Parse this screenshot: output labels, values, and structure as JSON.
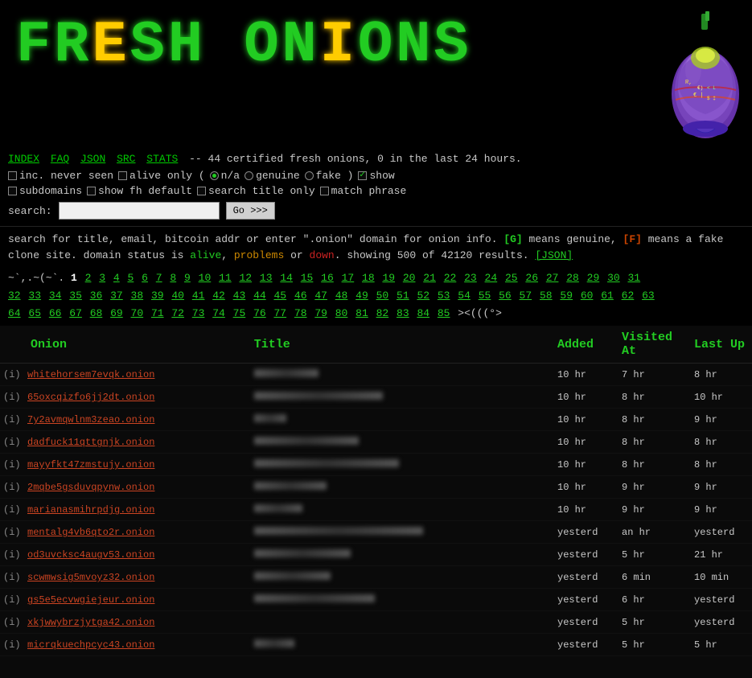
{
  "header": {
    "logo": "FRESH ONIONS",
    "tagline": "-- 44 certified fresh onions, 0 in the last 24 hours."
  },
  "nav": {
    "links": [
      "INDEX",
      "FAQ",
      "JSON",
      "SRC",
      "STATS"
    ],
    "tagline_prefix": "--",
    "certified_count": "44",
    "last24": "0"
  },
  "options": {
    "inc_never_seen_label": "inc. never seen",
    "alive_only_label": "alive only (",
    "na_label": "n/a",
    "genuine_label": "genuine",
    "fake_label": "fake )",
    "show_label": "show",
    "subdomains_label": "subdomains",
    "show_fh_default_label": "show fh default",
    "search_title_only_label": "search title only",
    "match_phrase_label": "match phrase"
  },
  "search": {
    "label": "search:",
    "placeholder": "",
    "button": "Go >>>"
  },
  "info": {
    "line1": "search for title, email, bitcoin addr or enter \".onion\" domain for onion info.",
    "genuine_badge": "[G]",
    "genuine_means": "means genuine,",
    "fake_badge": "[F]",
    "fake_means": "means a fake clone site. domain status is",
    "alive": "alive",
    "problems": "problems",
    "or": "or",
    "down": "down",
    "showing": "showing 500 of 42120 results.",
    "json_link": "[JSON]"
  },
  "pagination": {
    "prefix": "~`,.~(~`.",
    "current_page": "1",
    "pages": [
      "2",
      "3",
      "4",
      "5",
      "6",
      "7",
      "8",
      "9",
      "10",
      "11",
      "12",
      "13",
      "14",
      "15",
      "16",
      "17",
      "18",
      "19",
      "20",
      "21",
      "22",
      "23",
      "24",
      "25",
      "26",
      "27",
      "28",
      "29",
      "30",
      "31",
      "32",
      "33",
      "34",
      "35",
      "36",
      "37",
      "38",
      "39",
      "40",
      "41",
      "42",
      "43",
      "44",
      "45",
      "46",
      "47",
      "48",
      "49",
      "50",
      "51",
      "52",
      "53",
      "54",
      "55",
      "56",
      "57",
      "58",
      "59",
      "60",
      "61",
      "62",
      "63",
      "64",
      "65",
      "66",
      "67",
      "68",
      "69",
      "70",
      "71",
      "72",
      "73",
      "74",
      "75",
      "76",
      "77",
      "78",
      "79",
      "80",
      "81",
      "82",
      "83",
      "84",
      "85"
    ],
    "suffix": "><(((°>"
  },
  "table": {
    "headers": [
      "Onion",
      "Title",
      "Added",
      "Visited At",
      "Last Up"
    ],
    "rows": [
      {
        "info": "(i)",
        "onion": "whitehorsem7evqk.onion",
        "title_blur": true,
        "title": "",
        "added": "10 hr",
        "visited": "7 hr",
        "last_up": "8 hr"
      },
      {
        "info": "(i)",
        "onion": "65oxcqizfo6jj2dt.onion",
        "title_blur": true,
        "title": "blurred content here long text",
        "added": "10 hr",
        "visited": "8 hr",
        "last_up": "10 hr"
      },
      {
        "info": "(i)",
        "onion": "7y2avmqwlnm3zeao.onion",
        "title_blur": true,
        "title": "short",
        "added": "10 hr",
        "visited": "8 hr",
        "last_up": "9 hr"
      },
      {
        "info": "(i)",
        "onion": "dadfuck11qttgnjk.onion",
        "title_blur": true,
        "title": "medium blurred text",
        "added": "10 hr",
        "visited": "8 hr",
        "last_up": "8 hr"
      },
      {
        "info": "(i)",
        "onion": "mayyfkt47zmstujy.onion",
        "title_blur": true,
        "title": "some blurred title content goes here",
        "added": "10 hr",
        "visited": "8 hr",
        "last_up": "8 hr"
      },
      {
        "info": "(i)",
        "onion": "2mqbe5gsduvqpynw.onion",
        "title_blur": true,
        "title": "blurred title words",
        "added": "10 hr",
        "visited": "9 hr",
        "last_up": "9 hr"
      },
      {
        "info": "(i)",
        "onion": "marianasmihrpdjg.onion",
        "title_blur": true,
        "title": "blurred short",
        "added": "10 hr",
        "visited": "9 hr",
        "last_up": "9 hr"
      },
      {
        "info": "(i)",
        "onion": "mentalg4vb6qto2r.onion",
        "title_blur": true,
        "title": "blurred long title text content here extra",
        "added": "yesterd",
        "visited": "an hr",
        "last_up": "yesterd"
      },
      {
        "info": "(i)",
        "onion": "od3uvcksc4augv53.onion",
        "title_blur": true,
        "title": "blurred medium title",
        "added": "yesterd",
        "visited": "5 hr",
        "last_up": "21 hr"
      },
      {
        "info": "(i)",
        "onion": "scwmwsig5mvoyz32.onion",
        "title_blur": true,
        "title": "blurred text here",
        "added": "yesterd",
        "visited": "6 min",
        "last_up": "10 min"
      },
      {
        "info": "(i)",
        "onion": "gs5e5ecvwgiejeur.onion",
        "title_blur": true,
        "title": "blurred content short long",
        "added": "yesterd",
        "visited": "6 hr",
        "last_up": "yesterd"
      },
      {
        "info": "(i)",
        "onion": "xkjwwybrzjytga42.onion",
        "title_blur": true,
        "title": "",
        "added": "yesterd",
        "visited": "5 hr",
        "last_up": "yesterd"
      },
      {
        "info": "(i)",
        "onion": "micrqkuechpcyc43.onion",
        "title_blur": true,
        "title": "blurred",
        "added": "yesterd",
        "visited": "5 hr",
        "last_up": "5 hr"
      }
    ]
  }
}
